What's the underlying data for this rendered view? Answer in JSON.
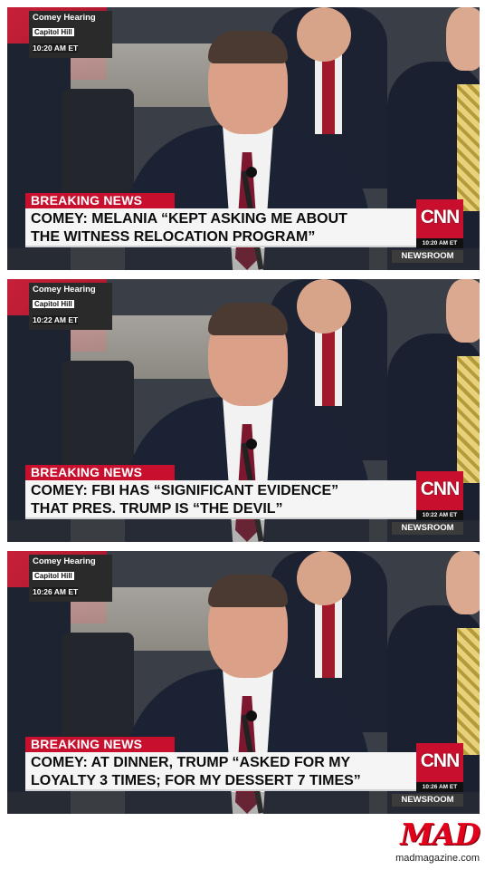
{
  "panels": [
    {
      "bug": {
        "show": "Comey Hearing",
        "location": "Capitol Hill",
        "time": "10:20 AM ET"
      },
      "label": "BREAKING NEWS",
      "headline": [
        "COMEY: MELANIA “KEPT ASKING ME ABOUT",
        "THE WITNESS RELOCATION PROGRAM”"
      ],
      "network": "CNN",
      "network_time": "10:20 AM ET",
      "program": "NEWSROOM"
    },
    {
      "bug": {
        "show": "Comey Hearing",
        "location": "Capitol Hill",
        "time": "10:22 AM ET"
      },
      "label": "BREAKING NEWS",
      "headline": [
        "COMEY: FBI HAS “SIGNIFICANT EVIDENCE”",
        "THAT PRES. TRUMP IS “THE DEVIL”"
      ],
      "network": "CNN",
      "network_time": "10:22 AM ET",
      "program": "NEWSROOM"
    },
    {
      "bug": {
        "show": "Comey Hearing",
        "location": "Capitol Hill",
        "time": "10:26 AM ET"
      },
      "label": "BREAKING NEWS",
      "headline": [
        "COMEY: AT DINNER, TRUMP “ASKED FOR MY",
        "LOYALTY 3 TIMES; FOR MY DESSERT 7 TIMES”"
      ],
      "network": "CNN",
      "network_time": "10:26 AM ET",
      "program": "NEWSROOM"
    }
  ],
  "footer": {
    "logo": "MAD",
    "url": "madmagazine.com"
  },
  "colors": {
    "cnn_red": "#c8102e",
    "mad_red": "#e2001a"
  }
}
